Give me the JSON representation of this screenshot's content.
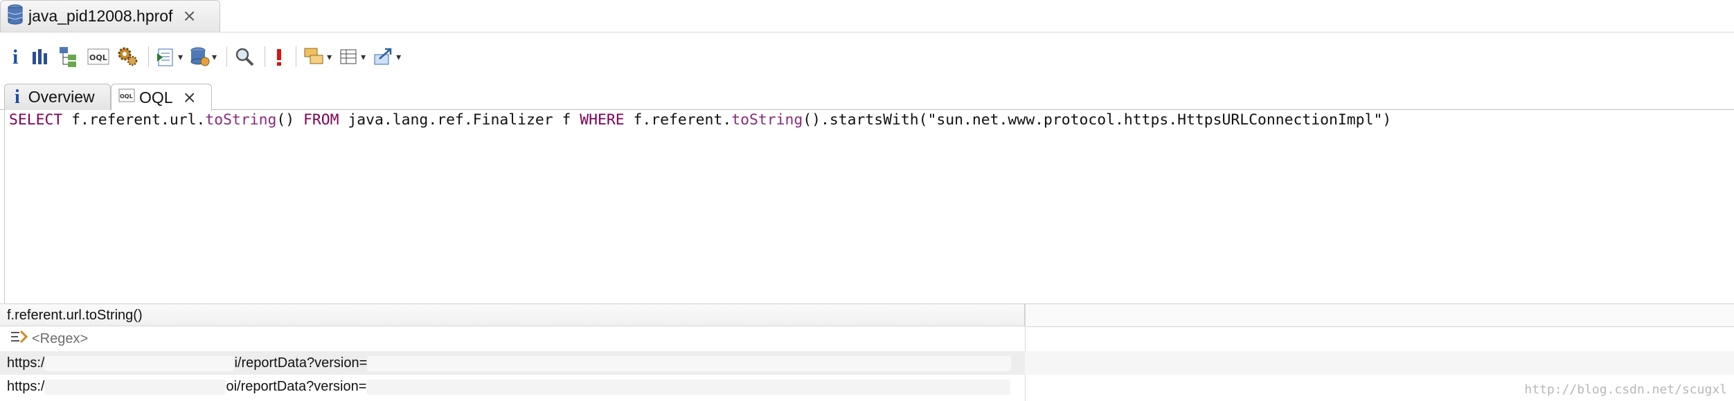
{
  "editor_tab": {
    "title": "java_pid12008.hprof",
    "close_icon": "close-icon"
  },
  "toolbar": {
    "buttons": [
      {
        "name": "info-icon"
      },
      {
        "name": "histogram-icon"
      },
      {
        "name": "dominator-tree-icon"
      },
      {
        "name": "oql-icon"
      },
      {
        "name": "settings-gears-icon"
      },
      {
        "name": "reports-icon"
      },
      {
        "name": "heap-dump-icon"
      },
      {
        "name": "search-icon"
      },
      {
        "name": "alert-icon"
      },
      {
        "name": "group-icon"
      },
      {
        "name": "layout-icon"
      },
      {
        "name": "export-icon"
      }
    ]
  },
  "view_tabs": [
    {
      "label": "Overview",
      "icon": "info-icon",
      "active": false
    },
    {
      "label": "OQL",
      "icon": "oql-icon",
      "active": true
    }
  ],
  "query": {
    "text": "SELECT f.referent.url.toString() FROM java.lang.ref.Finalizer f WHERE f.referent.toString().startsWith(\"sun.net.www.protocol.https.HttpsURLConnectionImpl\")",
    "parts": [
      "SELECT",
      " f.referent.url.",
      "toString",
      "() ",
      "FROM",
      " java.lang.ref.Finalizer f ",
      "WHERE",
      " f.referent.",
      "toString",
      "().startsWith(\"sun.net.www.protocol.https.HttpsURLConnectionImpl\")"
    ]
  },
  "results": {
    "column_header": "f.referent.url.toString()",
    "regex_placeholder": "<Regex>",
    "rows": [
      {
        "prefix": "https:/",
        "middle": "i/reportData?version="
      },
      {
        "prefix": "https:/",
        "middle": "oi/reportData?version="
      }
    ]
  },
  "watermark": "http://blog.csdn.net/scugxl",
  "colors": {
    "keyword": "#7f0055",
    "method": "#8a2a7a",
    "accent": "#1f4e9e"
  }
}
